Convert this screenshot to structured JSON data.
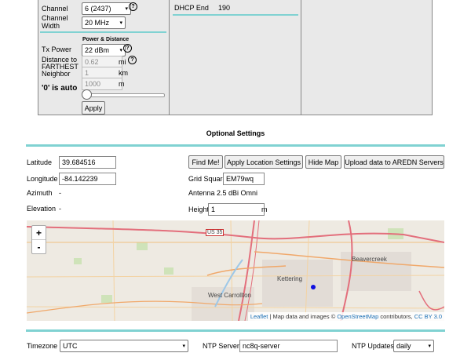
{
  "radio": {
    "channel_label": "Channel",
    "channel_value": "6 (2437)",
    "width_label": "Channel Width",
    "width_value": "20 MHz",
    "power_heading": "Power & Distance",
    "tx_label": "Tx Power",
    "tx_value": "22 dBm",
    "distance_label": "Distance to FARTHEST Neighbor",
    "dist_mi": "0.62",
    "dist_mi_unit": "mi",
    "dist_km": "1",
    "dist_km_unit": "km",
    "dist_m": "1000",
    "dist_m_unit": "m",
    "auto_note": "'0' is auto",
    "apply_label": "Apply"
  },
  "dhcp": {
    "end_label": "DHCP End",
    "end_value": "190"
  },
  "optional": {
    "title": "Optional Settings",
    "latitude_label": "Latitude",
    "latitude_value": "39.684516",
    "longitude_label": "Longitude",
    "longitude_value": "-84.142239",
    "azimuth_label": "Azimuth",
    "azimuth_value": "-",
    "elevation_label": "Elevation",
    "elevation_value": "-",
    "findme_label": "Find Me!",
    "apply_location_label": "Apply Location Settings",
    "hide_map_label": "Hide Map",
    "upload_label": "Upload data to AREDN Servers",
    "grid_label": "Grid Square",
    "grid_value": "EM79wq",
    "antenna_text": "Antenna 2.5 dBi Omni",
    "height_label": "Height",
    "height_value": "1",
    "height_unit": "m"
  },
  "map": {
    "zoom_in": "+",
    "zoom_out": "-",
    "places": {
      "us35": "US 35",
      "beavercreek": "Beavercreek",
      "kettering": "Kettering",
      "west_carrollton": "West Carrollton"
    },
    "attribution": {
      "leaflet": "Leaflet",
      "mid": " | Map data and images © ",
      "osm": "OpenStreetMap",
      "contrib": " contributors, ",
      "cc": "CC BY 3.0"
    }
  },
  "time": {
    "timezone_label": "Timezone",
    "timezone_value": "UTC",
    "ntp_label": "NTP Server",
    "ntp_value": "nc8q-server",
    "updates_label": "NTP Updates",
    "updates_value": "daily"
  }
}
